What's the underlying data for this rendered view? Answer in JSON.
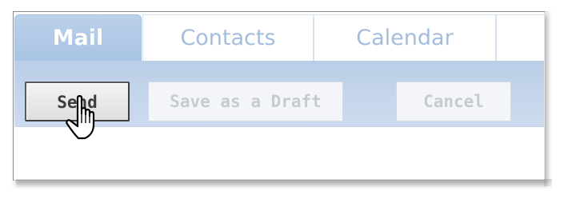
{
  "tabs": [
    {
      "label": "Mail",
      "active": true
    },
    {
      "label": "Contacts",
      "active": false
    },
    {
      "label": "Calendar",
      "active": false
    }
  ],
  "toolbar": {
    "send_label": "Send",
    "draft_label": "Save as a Draft",
    "cancel_label": "Cancel"
  },
  "colors": {
    "active_tab": "#a8c3e3",
    "inactive_tab_text": "#a4bddc",
    "toolbar_bg": "#c6d6ec",
    "disabled_text": "#c7cbd1"
  },
  "cursor": {
    "icon": "hand-pointer-icon"
  }
}
